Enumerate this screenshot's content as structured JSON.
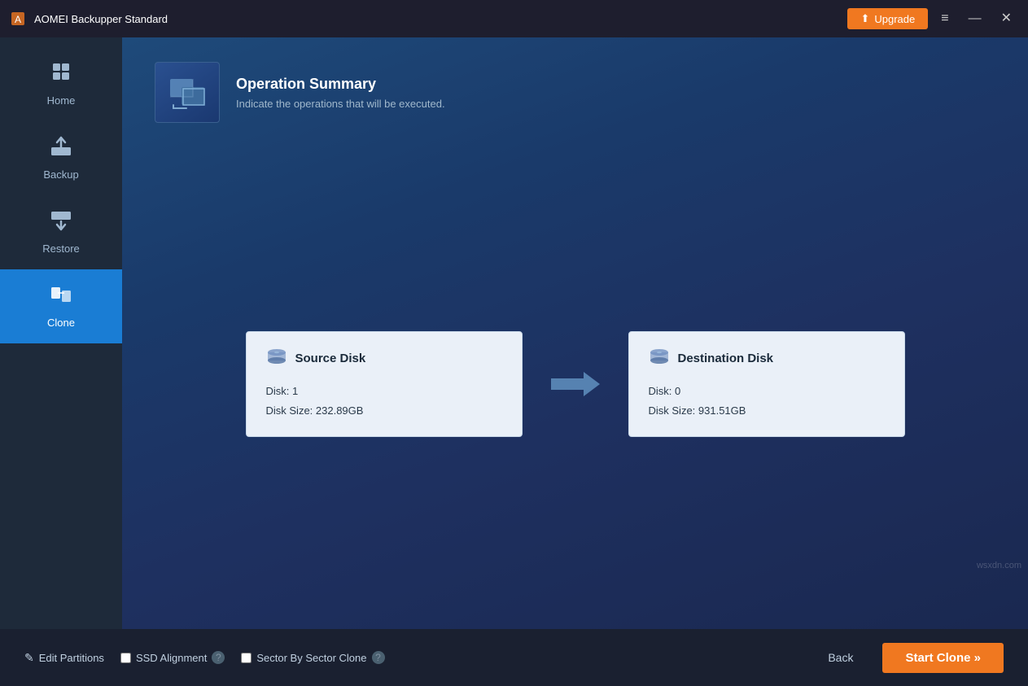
{
  "titlebar": {
    "title": "AOMEI Backupper Standard",
    "upgrade_label": "Upgrade",
    "upgrade_icon": "⬆",
    "menu_icon": "≡",
    "minimize_icon": "—",
    "close_icon": "✕"
  },
  "sidebar": {
    "items": [
      {
        "id": "home",
        "label": "Home",
        "icon": "🏠",
        "active": false
      },
      {
        "id": "backup",
        "label": "Backup",
        "icon": "📤",
        "active": false
      },
      {
        "id": "restore",
        "label": "Restore",
        "icon": "📥",
        "active": false
      },
      {
        "id": "clone",
        "label": "Clone",
        "icon": "📋",
        "active": true
      }
    ]
  },
  "header": {
    "title": "Operation Summary",
    "subtitle": "Indicate the operations that will be executed."
  },
  "source_disk": {
    "title": "Source Disk",
    "disk_number": "Disk: 1",
    "disk_size": "Disk Size: 232.89GB"
  },
  "destination_disk": {
    "title": "Destination Disk",
    "disk_number": "Disk: 0",
    "disk_size": "Disk Size: 931.51GB"
  },
  "footer": {
    "edit_partitions_label": "Edit Partitions",
    "ssd_alignment_label": "SSD Alignment",
    "sector_clone_label": "Sector By Sector Clone",
    "back_label": "Back",
    "start_clone_label": "Start Clone »"
  },
  "watermark": "wsxdn.com"
}
